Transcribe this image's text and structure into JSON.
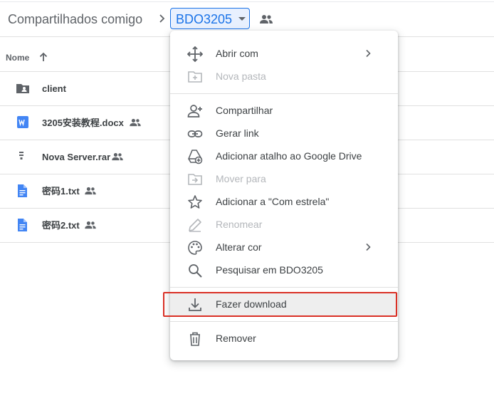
{
  "breadcrumb": {
    "root": "Compartilhados comigo",
    "current": "BDO3205"
  },
  "list": {
    "column_name": "Nome",
    "files": [
      {
        "name": "client",
        "icon": "shared-folder-icon",
        "shared": false
      },
      {
        "name": "3205安装教程.docx",
        "icon": "word-doc-icon",
        "shared": true
      },
      {
        "name": "Nova Server.rar",
        "icon": "archive-icon",
        "shared": true
      },
      {
        "name": "密码1.txt",
        "icon": "text-doc-icon",
        "shared": true
      },
      {
        "name": "密码2.txt",
        "icon": "text-doc-icon",
        "shared": true
      }
    ]
  },
  "context_menu": {
    "items": [
      {
        "label": "Abrir com",
        "icon": "move-arrows-icon",
        "enabled": true,
        "submenu": true
      },
      {
        "label": "Nova pasta",
        "icon": "new-folder-icon",
        "enabled": false,
        "submenu": false
      },
      {
        "label": "Compartilhar",
        "icon": "add-person-icon",
        "enabled": true,
        "submenu": false
      },
      {
        "label": "Gerar link",
        "icon": "link-icon",
        "enabled": true,
        "submenu": false
      },
      {
        "label": "Adicionar atalho ao Google Drive",
        "icon": "add-shortcut-drive-icon",
        "enabled": true,
        "submenu": false
      },
      {
        "label": "Mover para",
        "icon": "move-to-folder-icon",
        "enabled": false,
        "submenu": false
      },
      {
        "label": "Adicionar a \"Com estrela\"",
        "icon": "star-icon",
        "enabled": true,
        "submenu": false
      },
      {
        "label": "Renomear",
        "icon": "pencil-icon",
        "enabled": false,
        "submenu": false
      },
      {
        "label": "Alterar cor",
        "icon": "palette-icon",
        "enabled": true,
        "submenu": true
      },
      {
        "label": "Pesquisar em BDO3205",
        "icon": "search-icon",
        "enabled": true,
        "submenu": false
      },
      {
        "label": "Fazer download",
        "icon": "download-icon",
        "enabled": true,
        "submenu": false,
        "highlighted": true
      },
      {
        "label": "Remover",
        "icon": "trash-icon",
        "enabled": true,
        "submenu": false
      }
    ]
  },
  "colors": {
    "accent": "#1a73e8",
    "highlight_border": "#d93025",
    "icon_gray": "#5f6368",
    "disabled": "#b4b7bb",
    "word_blue": "#4285f4"
  }
}
